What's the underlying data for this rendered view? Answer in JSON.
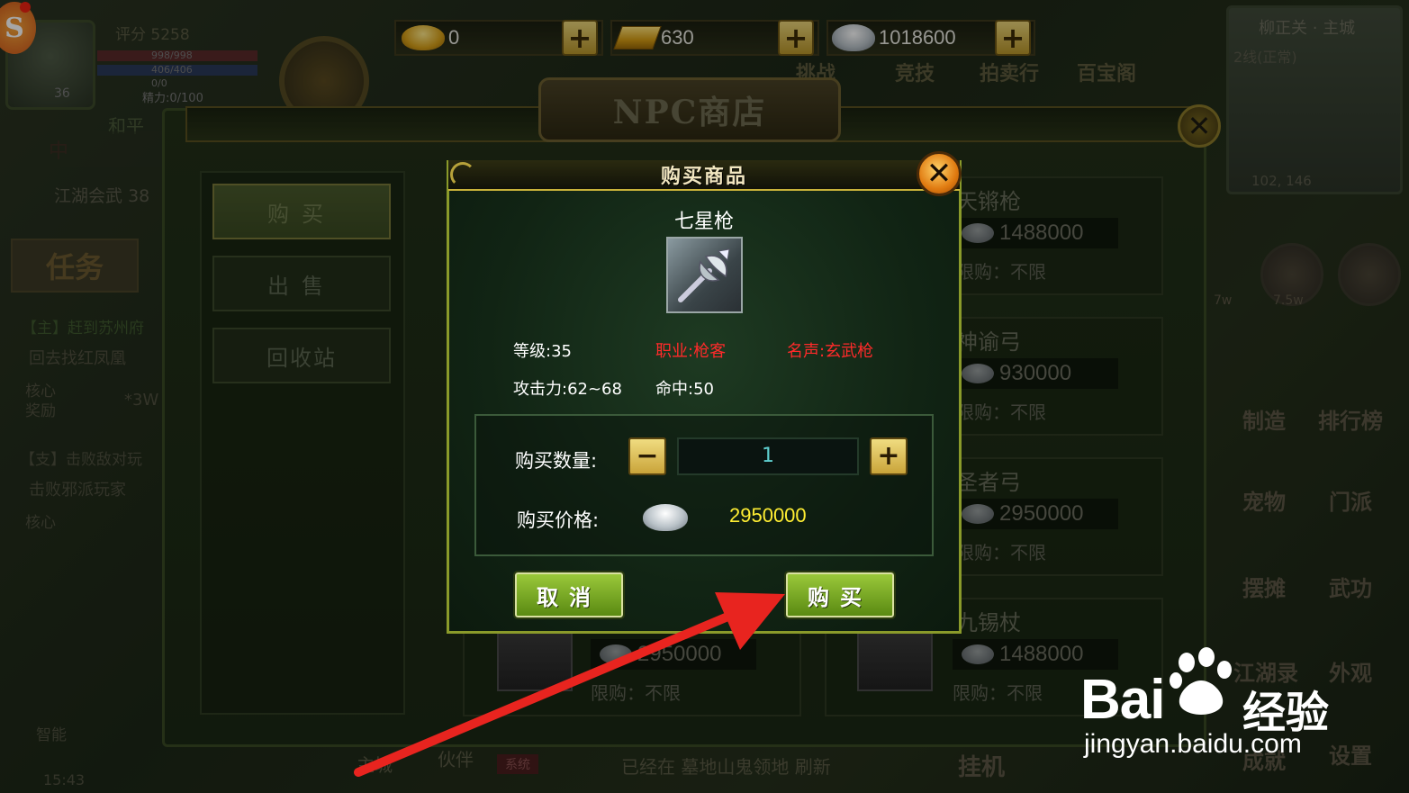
{
  "hud": {
    "score": "评分 5258",
    "level": "36",
    "hp": "998/998",
    "mp": "406/406",
    "zero": "0/0",
    "energy": "精力:0/100",
    "peace": "和平",
    "camp": "中"
  },
  "currency": {
    "ingot": "0",
    "gold": "630",
    "silver": "1018600"
  },
  "top_menu": [
    "挑战",
    "竞技",
    "拍卖行",
    "百宝阁"
  ],
  "minimap": {
    "title": "柳正关 · 主城",
    "line": "2线(正常)",
    "coord": "102, 146"
  },
  "left_panel": {
    "jianghu": "江湖会武",
    "jianghu_num": "38",
    "task": "任务",
    "q1": "【主】赶到苏州府",
    "q2": "回去找红凤凰",
    "core_reward": "核心奖励",
    "reward_x": "*3W",
    "q5": "【支】击败敌对玩",
    "q6": "击败邪派玩家",
    "core": "核心",
    "auto": "智能",
    "time": "15:43"
  },
  "right_hud": [
    "制造",
    "排行榜",
    "宠物",
    "门派",
    "摆摊",
    "武功",
    "江湖录",
    "外观",
    "成就",
    "设置"
  ],
  "right_hud_small": [
    "7w",
    "7.5w"
  ],
  "shop": {
    "title": "NPC商店",
    "tabs": [
      "购买",
      "出售",
      "回收站"
    ],
    "items": [
      {
        "name": "天锵枪",
        "price": "1488000",
        "limit": "限购：不限"
      },
      {
        "name": "神谕弓",
        "price": "930000",
        "limit": "限购：不限"
      },
      {
        "name": "圣者弓",
        "price": "2950000",
        "limit": "限购：不限"
      },
      {
        "name": "九锡杖",
        "price": "1488000",
        "limit": "限购：不限"
      },
      {
        "name": "",
        "price": "2950000",
        "limit": "限购：不限"
      }
    ]
  },
  "chat": {
    "tag": "系统",
    "text": "已经在 墓地山鬼领地 刷新",
    "hang": "挂机",
    "chan": "主城",
    "partner": "伙伴"
  },
  "dialog": {
    "title": "购买商品",
    "item_name": "七星枪",
    "level": "等级:35",
    "job": "职业:枪客",
    "fame": "名声:玄武枪",
    "attack": "攻击力:62~68",
    "hit": "命中:50",
    "qty_label": "购买数量:",
    "qty_value": "1",
    "price_label": "购买价格:",
    "price_value": "2950000",
    "cancel": "取消",
    "buy": "购买"
  },
  "watermark": {
    "bai": "Bai",
    "cn": "经验",
    "url": "jingyan.baidu.com"
  },
  "colors": {
    "annotation_arrow": "#e8241f",
    "gold_button": "#d9bb4a",
    "dialog_border": "#8a9a2a",
    "price_yellow": "#ffee33",
    "stat_red": "#ff2a2a"
  }
}
